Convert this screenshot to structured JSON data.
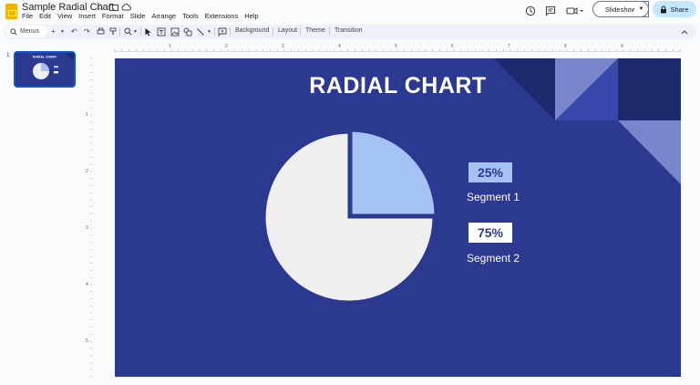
{
  "app": {
    "doc_title": "Sample Radial Chart",
    "menu": [
      "File",
      "Edit",
      "View",
      "Insert",
      "Format",
      "Slide",
      "Arrange",
      "Tools",
      "Extensions",
      "Help"
    ],
    "slideshow_label": "Slideshow",
    "share_label": "Share"
  },
  "toolbar": {
    "search_label": "Menus",
    "background_label": "Background",
    "layout_label": "Layout",
    "theme_label": "Theme",
    "transition_label": "Transition"
  },
  "ruler": {
    "h_ticks": [
      "1",
      "2",
      "3",
      "4",
      "5",
      "6",
      "7",
      "8",
      "9"
    ],
    "v_ticks": [
      "1",
      "2",
      "3",
      "4",
      "5"
    ]
  },
  "filmstrip": {
    "slide_number": "1"
  },
  "slide": {
    "title": "RADIAL CHART",
    "segments": [
      {
        "percent": "25%",
        "label": "Segment 1",
        "box_color": "#a4c2f4",
        "text_color": "#2b3990"
      },
      {
        "percent": "75%",
        "label": "Segment 2",
        "box_color": "#ffffff",
        "text_color": "#2b3990"
      }
    ],
    "colors": {
      "background": "#2b3990",
      "segment1": "#a4c2f4",
      "segment2": "#efefef"
    }
  },
  "chart_data": {
    "type": "pie",
    "categories": [
      "Segment 1",
      "Segment 2"
    ],
    "values": [
      25,
      75
    ],
    "labels": [
      "25%",
      "75%"
    ],
    "title": "RADIAL CHART"
  }
}
